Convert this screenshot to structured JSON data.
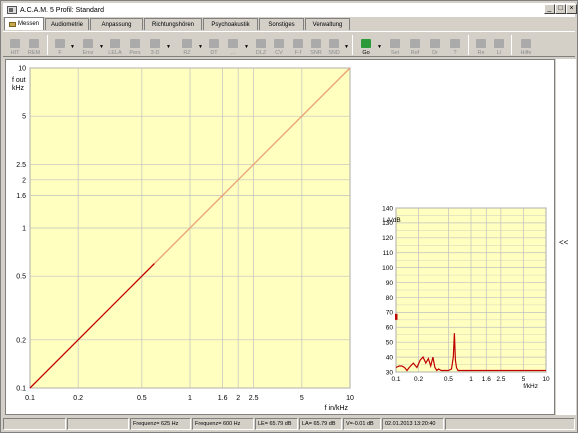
{
  "window": {
    "title": "A.C.A.M. 5  Profil: Standard",
    "min": "_",
    "max": "□",
    "close": "×"
  },
  "tabs": [
    "Messen",
    "Audiometrie",
    "Anpassung",
    "Richtungshören",
    "Psychoakustik",
    "Sonstiges",
    "Verwaltung"
  ],
  "toolbar": {
    "buttons": [
      "HIT",
      "REM",
      "F",
      "Emz",
      "LELA",
      "Pers",
      "3-D",
      "RZ",
      "DT",
      "...",
      "DLZ",
      "CV",
      "F-f",
      "SNR",
      "SND",
      "Go",
      "Set",
      "Ref",
      "Dr",
      "?",
      "Re",
      "Li",
      "Hilfe"
    ],
    "arrow": "▼"
  },
  "collapse_label": "<<",
  "status": {
    "f1": "Frequenz= 625 Hz",
    "f2": "Frequenz= 600 Hz",
    "le": "LE= 65.79 dB",
    "la": "LA= 65.79 dB",
    "v": "V=-0.01 dB",
    "datetime": "02.01.2013 13:20:40"
  },
  "colors": {
    "plot_bg": "#ffffc0",
    "grid": "#c0c0c0",
    "curve": "#c00000",
    "curve_light": "#e8a070"
  },
  "chart_data": [
    {
      "type": "line",
      "xlabel": "f in/kHz",
      "ylabel": "f out\nkHz",
      "xscale": "log",
      "yscale": "log",
      "xlim": [
        0.1,
        10
      ],
      "ylim": [
        0.1,
        10
      ],
      "xticks": [
        "0.1",
        "0.2",
        "0.5",
        "1",
        "1.6",
        "2",
        "2.5",
        "5",
        "10"
      ],
      "yticks": [
        "0.1",
        "0.2",
        "0.5",
        "1",
        "1.6",
        "2",
        "2.5",
        "5",
        "10"
      ],
      "grid": true,
      "series": [
        {
          "x": [
            0.1,
            0.6
          ],
          "y": [
            0.1,
            0.6
          ]
        },
        {
          "x": [
            0.6,
            10
          ],
          "y": [
            0.6,
            10
          ]
        }
      ]
    },
    {
      "type": "line",
      "xlabel": "f/kHz",
      "ylabel": "LA/dB",
      "xscale": "log",
      "xlim": [
        0.1,
        10
      ],
      "ylim": [
        30,
        140
      ],
      "xticks": [
        "0.1",
        "0.2",
        "0.5",
        "1",
        "1.6",
        "2.5",
        "5",
        "10"
      ],
      "yticks": [
        "30",
        "40",
        "50",
        "60",
        "70",
        "80",
        "90",
        "100",
        "110",
        "120",
        "130",
        "140"
      ],
      "grid": true,
      "series": [
        {
          "x": [
            0.1,
            0.11,
            0.12,
            0.13,
            0.14,
            0.15,
            0.17,
            0.19,
            0.21,
            0.23,
            0.25,
            0.27,
            0.29,
            0.31,
            0.33,
            0.35,
            0.37,
            0.4,
            0.45,
            0.5,
            0.55,
            0.58,
            0.6,
            0.62,
            0.64,
            0.67,
            0.7,
            0.8,
            1,
            2,
            5,
            10
          ],
          "y": [
            33,
            34,
            34,
            33,
            31,
            33,
            36,
            33,
            38,
            40,
            36,
            39,
            34,
            40,
            33,
            31,
            32,
            31,
            31,
            31,
            32,
            40,
            56,
            38,
            33,
            31,
            31,
            31,
            31,
            31,
            31,
            31
          ]
        }
      ],
      "marker": {
        "x": 0.1,
        "y": 67
      }
    }
  ]
}
